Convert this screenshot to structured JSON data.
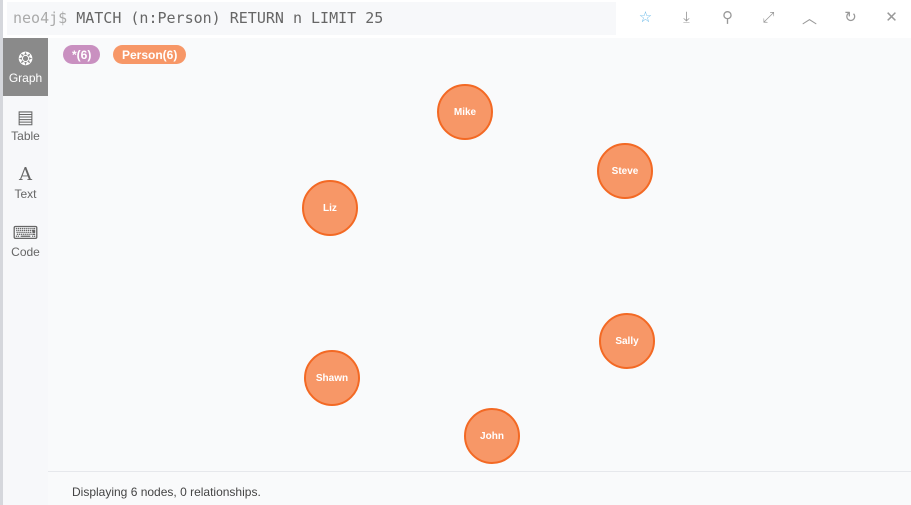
{
  "editor": {
    "prompt": "neo4j$",
    "query": " MATCH (n:Person) RETURN n LIMIT 25"
  },
  "toolbar": [
    "star-icon",
    "download-icon",
    "pin-icon",
    "expand-icon",
    "collapse-icon",
    "refresh-icon",
    "close-icon"
  ],
  "sidebar": [
    {
      "label": "Graph",
      "icon": "graph-icon",
      "active": true
    },
    {
      "label": "Table",
      "icon": "table-icon"
    },
    {
      "label": "Text",
      "icon": "text-icon"
    },
    {
      "label": "Code",
      "icon": "code-icon"
    }
  ],
  "tags": [
    {
      "label": "*(6)",
      "color": "#c990c0"
    },
    {
      "label": "Person(6)",
      "color": "#f79767"
    }
  ],
  "nodes": [
    "Mike",
    "Steve",
    "Liz",
    "Sally",
    "Shawn",
    "John"
  ],
  "node_color": "#f79767",
  "status": "Displaying 6 nodes, 0 relationships."
}
